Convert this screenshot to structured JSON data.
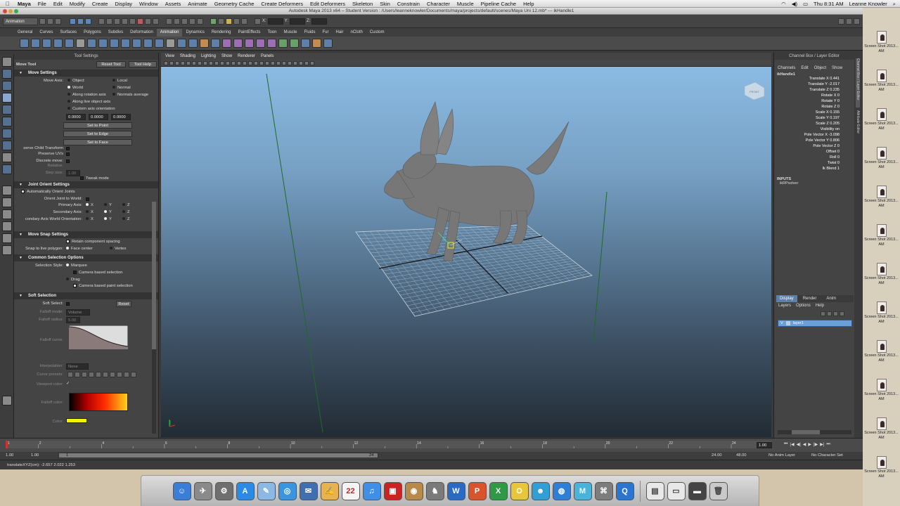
{
  "menubar": {
    "apple": "",
    "app": "Maya",
    "items": [
      "File",
      "Edit",
      "Modify",
      "Create",
      "Display",
      "Window",
      "Assets",
      "Animate",
      "Geometry Cache",
      "Create Deformers",
      "Edit Deformers",
      "Skeleton",
      "Skin",
      "Constrain",
      "Character",
      "Muscle",
      "Pipeline Cache",
      "Help"
    ],
    "clock": "Thu 8:31 AM",
    "user": "Leanne Knowler"
  },
  "window": {
    "title": "Autodesk Maya 2013 x64 – Student Version : /Users/leanneknowler/Documents/maya/projects/default/scenes/Maya Uni 12.mb*  ---  ikHandle1"
  },
  "statusline": {
    "menuset": "Animation",
    "x_label": "X:",
    "y_label": "Y:",
    "z_label": "Z:"
  },
  "shelf": {
    "tabs": [
      "General",
      "Curves",
      "Surfaces",
      "Polygons",
      "Subdivs",
      "Deformation",
      "Animation",
      "Dynamics",
      "Rendering",
      "PaintEffects",
      "Toon",
      "Muscle",
      "Fluids",
      "Fur",
      "Hair",
      "nCloth",
      "Custom"
    ],
    "active": "Animation"
  },
  "tool_settings": {
    "header": "Tool Settings",
    "tool_name": "Move Tool",
    "reset": "Reset Tool",
    "help": "Tool Help",
    "move_settings": "Move Settings",
    "move_axis": "Move Axis:",
    "axis_options": [
      "Object",
      "Local",
      "World",
      "Normal",
      "Along rotation axis",
      "Normals average",
      "Along live object axis",
      "Custom axis orientation"
    ],
    "xyz": [
      "0.0000",
      "0.0000",
      "0.0000"
    ],
    "set_point": "Set to Point",
    "set_edge": "Set to Edge",
    "set_face": "Set to Face",
    "preserve_child": "serve Child Transform",
    "preserve_uvs": "Preserve UVs",
    "discrete_move": "Discrete move:",
    "relative": "Relative:",
    "step_size": "Step size:",
    "step_value": "1.00",
    "tweak_mode": "Tweak mode",
    "joint_orient": "Joint Orient Settings",
    "auto_orient": "Automatically Orient Joints",
    "orient_world": "Orient Joint to World:",
    "primary_axis": "Primary Axis:",
    "secondary_axis": "Secondary Axis:",
    "secondary_world": "condary Axis World Orientation:",
    "axis_letters": [
      "X",
      "Y",
      "Z"
    ],
    "snap_settings": "Move Snap Settings",
    "retain_spacing": "Retain component spacing",
    "snap_live": "Snap to live polygon:",
    "face_center": "Face center",
    "vertex": "Vertex",
    "common_selection": "Common Selection Options",
    "selection_style": "Selection Style:",
    "marquee": "Marquee",
    "camera_based": "Camera based selection",
    "drag": "Drag",
    "camera_paint": "Camera based paint selection",
    "soft_selection": "Soft Selection",
    "soft_select": "Soft Select:",
    "soft_reset": "Reset",
    "falloff_mode": "Falloff mode:",
    "falloff_mode_value": "Volume",
    "falloff_radius": "Falloff radius:",
    "falloff_radius_value": "5.00",
    "falloff_curve": "Falloff curve:",
    "interpolation": "Interpolation:",
    "interpolation_value": "None",
    "curve_presets": "Curve presets:",
    "viewport_color": "Viewport color:",
    "falloff_color": "Falloff color:",
    "color": "Color:"
  },
  "viewport": {
    "menus": [
      "View",
      "Shading",
      "Lighting",
      "Show",
      "Renderer",
      "Panels"
    ],
    "cube_label": "FRONT"
  },
  "channel_box": {
    "header": "Channel Box / Layer Editor",
    "menus": [
      "Channels",
      "Edit",
      "Object",
      "Show"
    ],
    "object": "ikHandle1",
    "channels": [
      "Translate X 0.441",
      "Translate Y -2.017",
      "Translate Z 0.235",
      "Rotate X 0",
      "Rotate Y 0",
      "Rotate Z 0",
      "Scale X 0.155",
      "Scale Y 0.197",
      "Scale Z 0.205",
      "Visibility on",
      "Pole Vector X -3.098",
      "Pole Vector Y 0.806",
      "Pole Vector Z 0",
      "Offset 0",
      "Roll 0",
      "Twist 0",
      "Ik Blend 1"
    ],
    "inputs_label": "INPUTS",
    "inputs_item": "ikRPsolver",
    "layer_tabs": [
      "Display",
      "Render",
      "Anim"
    ],
    "layer_menus": [
      "Layers",
      "Options",
      "Help"
    ],
    "layer_name": "layer1",
    "layer_v": "V"
  },
  "time_slider": {
    "ticks": [
      "1",
      "2",
      "4",
      "6",
      "8",
      "10",
      "12",
      "14",
      "16",
      "18",
      "20",
      "22",
      "24"
    ],
    "current_frame": "1.00"
  },
  "range_slider": {
    "start": "1.00",
    "start2": "1.00",
    "range_start": "1",
    "range_end": "24",
    "end": "24.00",
    "end2": "48.00",
    "anim_layer": "No Anim Layer",
    "char_set": "No Character Set"
  },
  "command_line": {
    "feedback": "translateXYZ(cm):  -2.657    2.022    1.253"
  },
  "desktop": {
    "icon_label": "Screen Shot 2013...",
    "icon_suffix": "AM"
  },
  "dock": {
    "items": [
      "Finder",
      "Rocket",
      "Preview",
      "App Store",
      "Safari",
      "Mail",
      "Pages",
      "Calendar",
      "iTunes",
      "Photo Booth",
      "Preview2",
      "Chess",
      "Word",
      "Powerpoint",
      "Excel",
      "Dictionary",
      "Maya",
      "Network",
      "Lion",
      "QuickTime"
    ]
  }
}
